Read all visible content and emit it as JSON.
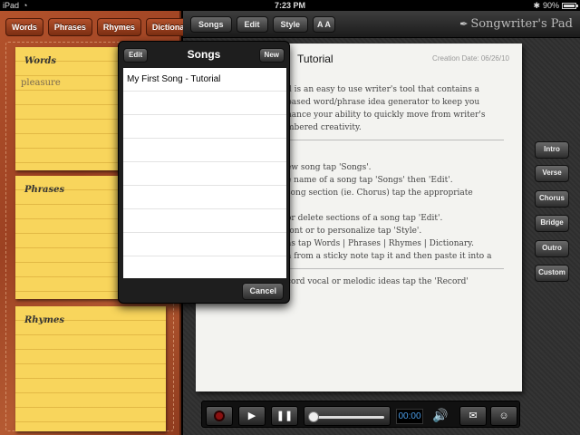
{
  "status_bar": {
    "carrier": "iPad",
    "time": "7:23 PM",
    "battery": "90%",
    "battery_level": 0.9
  },
  "left_tabs": [
    "Words",
    "Phrases",
    "Rhymes",
    "Dictionary"
  ],
  "stickies": {
    "words": {
      "title": "Words",
      "entry": "pleasure"
    },
    "phrases": {
      "title": "Phrases"
    },
    "rhymes": {
      "title": "Rhymes"
    }
  },
  "top_toolbar": {
    "songs": "Songs",
    "edit": "Edit",
    "style": "Style",
    "font_size": "A A"
  },
  "brand": "Songwriter's Pad",
  "document": {
    "title": "Tutorial",
    "creation_date": "Creation Date: 06/26/10",
    "intro_lines": [
      "d is an easy to use writer's tool that contains a",
      "based word/phrase idea generator to keep you",
      "nance your ability to quickly move from writer's",
      "mbered creativity."
    ],
    "body_lines": [
      "ew song tap 'Songs'.",
      "e name of a song tap 'Songs' then 'Edit'.",
      " song section (ie. Chorus) tap the appropriate",
      "",
      " or delete sections of a song tap 'Edit'.",
      "font or to personalize tap 'Style'.",
      "as tap Words | Phrases | Rhymes | Dictionary.",
      "a from a sticky note tap it and then paste it into a",
      "",
      "cord vocal or melodic ideas tap the 'Record'"
    ]
  },
  "sections": [
    "Intro",
    "Verse",
    "Chorus",
    "Bridge",
    "Outro",
    "Custom"
  ],
  "player": {
    "time": "00:00",
    "progress": 0.0
  },
  "songs_popover": {
    "title": "Songs",
    "edit": "Edit",
    "new": "New",
    "songs": [
      "My First Song - Tutorial"
    ],
    "cancel": "Cancel"
  },
  "icons": [
    "wifi-icon",
    "battery-icon",
    "pen-icon",
    "record-icon",
    "play-icon",
    "pause-icon",
    "volume-icon",
    "mail-icon",
    "contact-icon"
  ]
}
